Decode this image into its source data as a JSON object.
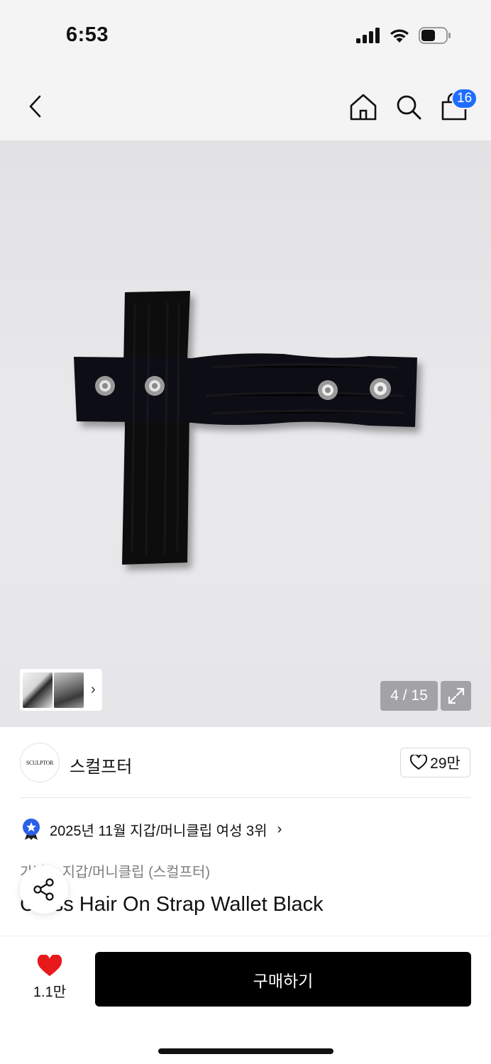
{
  "status_bar": {
    "time": "6:53"
  },
  "nav": {
    "cart_count": "16"
  },
  "gallery": {
    "page_counter": "4 / 15"
  },
  "brand": {
    "logo_text": "SCULPTOR",
    "name": "스컬프터",
    "likes": "29만"
  },
  "ranking": {
    "text": "2025년 11월 지갑/머니클립 여성 3위"
  },
  "product": {
    "category_path": "가방 > 지갑/머니클립 (스컬프터)",
    "title": "Cross Hair On Strap Wallet Black"
  },
  "bottom": {
    "favorite_count": "1.1만",
    "buy_label": "구매하기"
  },
  "colors": {
    "badge": "#1f6dff",
    "heart": "#e8191b",
    "buy_bg": "#000000"
  },
  "icons": [
    "back-chevron-icon",
    "home-icon",
    "search-icon",
    "shopping-bag-icon",
    "expand-icon",
    "star-medal-icon",
    "heart-outline-icon",
    "share-icon",
    "heart-filled-icon"
  ]
}
